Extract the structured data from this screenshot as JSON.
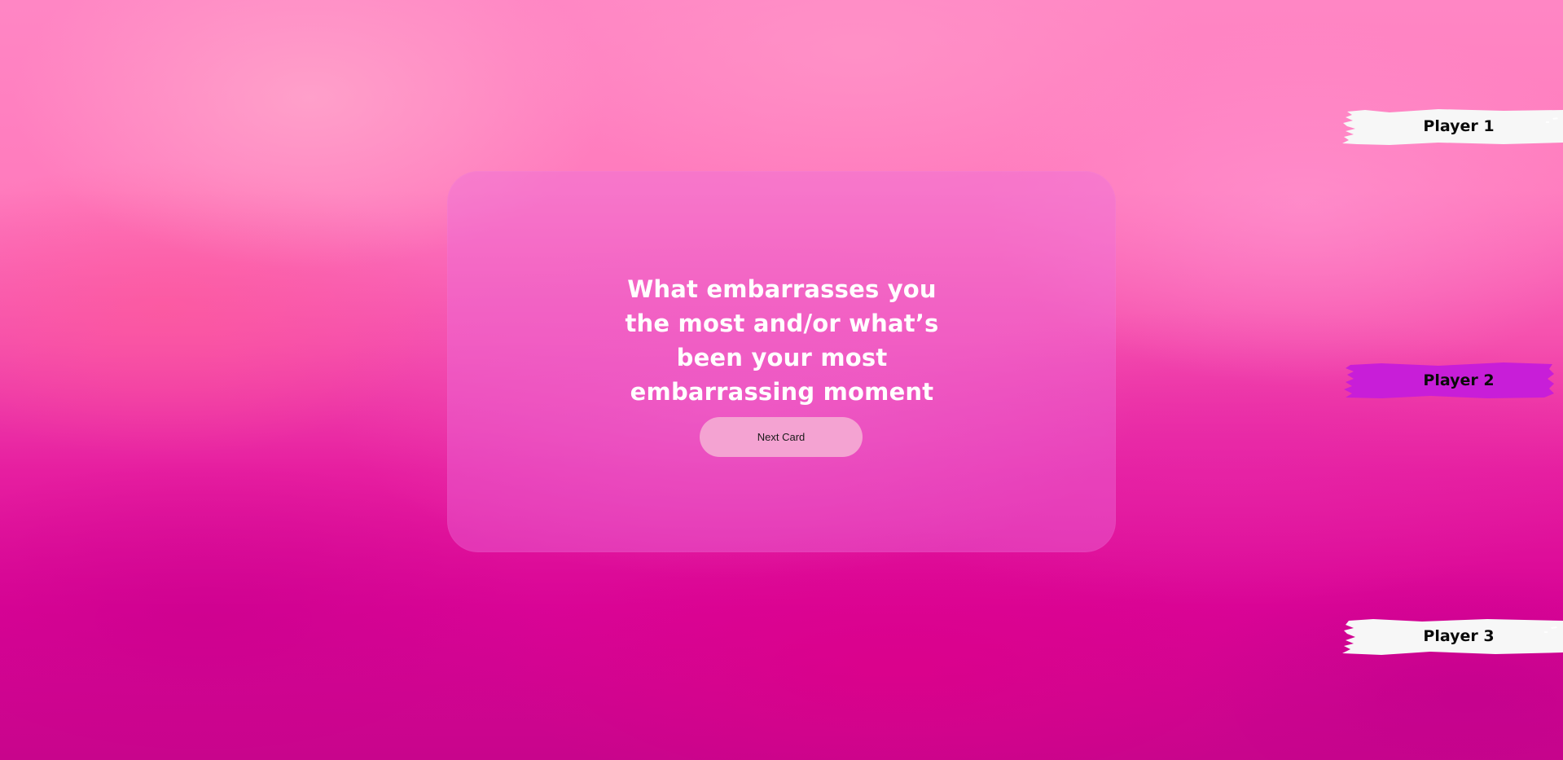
{
  "card": {
    "question": "What embarrasses you the most and/or what’s been your most embarrassing moment",
    "next_label": "Next Card"
  },
  "players": [
    {
      "label": "Player 1",
      "color": "#f7f7f7",
      "active": false
    },
    {
      "label": "Player 2",
      "color": "#c81ed8",
      "active": true
    },
    {
      "label": "Player 3",
      "color": "#f7f7f7",
      "active": false
    }
  ],
  "colors": {
    "button_bg": "#f4a3d2",
    "question_text": "#ffffff",
    "player_text": "#0a0a0a"
  }
}
